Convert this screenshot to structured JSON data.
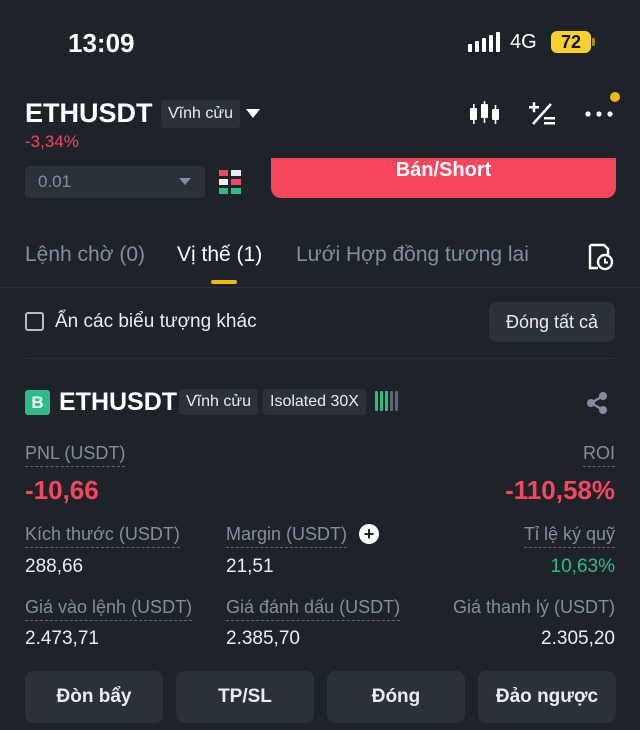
{
  "status_bar": {
    "time": "13:09",
    "network": "4G",
    "battery": "72"
  },
  "header": {
    "symbol": "ETHUSDT",
    "contract_type": "Vĩnh cửu",
    "change_pct": "-3,34%",
    "icons": [
      "candlestick-icon",
      "calculator-icon",
      "more-icon"
    ]
  },
  "order": {
    "quantity_value": "0.01",
    "short_button": "Bán/Short"
  },
  "tabs": [
    {
      "label": "Lệnh chờ (0)"
    },
    {
      "label": "Vị thế (1)"
    },
    {
      "label": "Lưới Hợp đồng tương lai"
    }
  ],
  "filter": {
    "hide_others_label": "Ẩn các biểu tượng khác",
    "close_all_label": "Đóng tất cả"
  },
  "position": {
    "side_badge": "B",
    "symbol": "ETHUSDT",
    "contract_type": "Vĩnh cửu",
    "margin_mode": "Isolated 30X",
    "pnl_label": "PNL (USDT)",
    "pnl_value": "-10,66",
    "roi_label": "ROI",
    "roi_value": "-110,58%",
    "size_label": "Kích thước (USDT)",
    "size_value": "288,66",
    "margin_label": "Margin (USDT)",
    "margin_value": "21,51",
    "margin_ratio_label": "Tỉ lệ ký quỹ",
    "margin_ratio_value": "10,63%",
    "entry_label": "Giá vào lệnh (USDT)",
    "entry_value": "2.473,71",
    "mark_label": "Giá đánh dấu (USDT)",
    "mark_value": "2.385,70",
    "liq_label": "Giá thanh lý (USDT)",
    "liq_value": "2.305,20"
  },
  "actions": {
    "leverage": "Đòn bẩy",
    "tpsl": "TP/SL",
    "close": "Đóng",
    "reverse": "Đảo ngược"
  },
  "colors": {
    "background": "#1e2329",
    "surface": "#2b3139",
    "sell": "#f6465d",
    "buy": "#2ebd85",
    "accent": "#f0b90b"
  }
}
